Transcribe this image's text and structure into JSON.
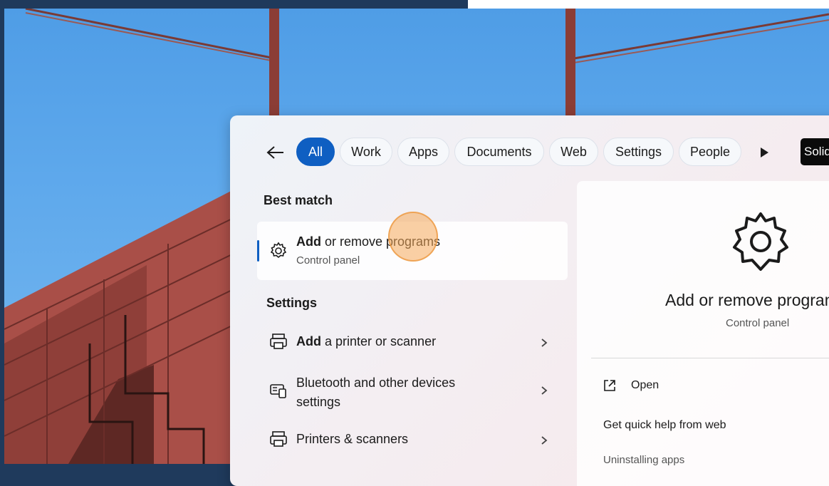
{
  "search": {
    "filters": [
      "All",
      "Work",
      "Apps",
      "Documents",
      "Web",
      "Settings",
      "People"
    ],
    "active_filter": "All",
    "badge": "Solid"
  },
  "best_match": {
    "heading": "Best match",
    "title_bold": "Add",
    "title_rest": " or remove programs",
    "subtitle": "Control panel"
  },
  "settings": {
    "heading": "Settings",
    "items": [
      {
        "bold": "Add",
        "rest": " a printer or scanner"
      },
      {
        "bold": "",
        "rest": "Bluetooth and other devices",
        "rest2": "settings"
      },
      {
        "bold": "",
        "rest": "Printers & scanners"
      }
    ]
  },
  "preview": {
    "title": "Add or remove programs",
    "subtitle": "Control panel",
    "open_label": "Open",
    "help_title": "Get quick help from web",
    "help_link": "Uninstalling apps"
  },
  "colors": {
    "accent": "#0f5fc2",
    "sky": "#5fa9ec",
    "bridge": "#b5544c"
  }
}
